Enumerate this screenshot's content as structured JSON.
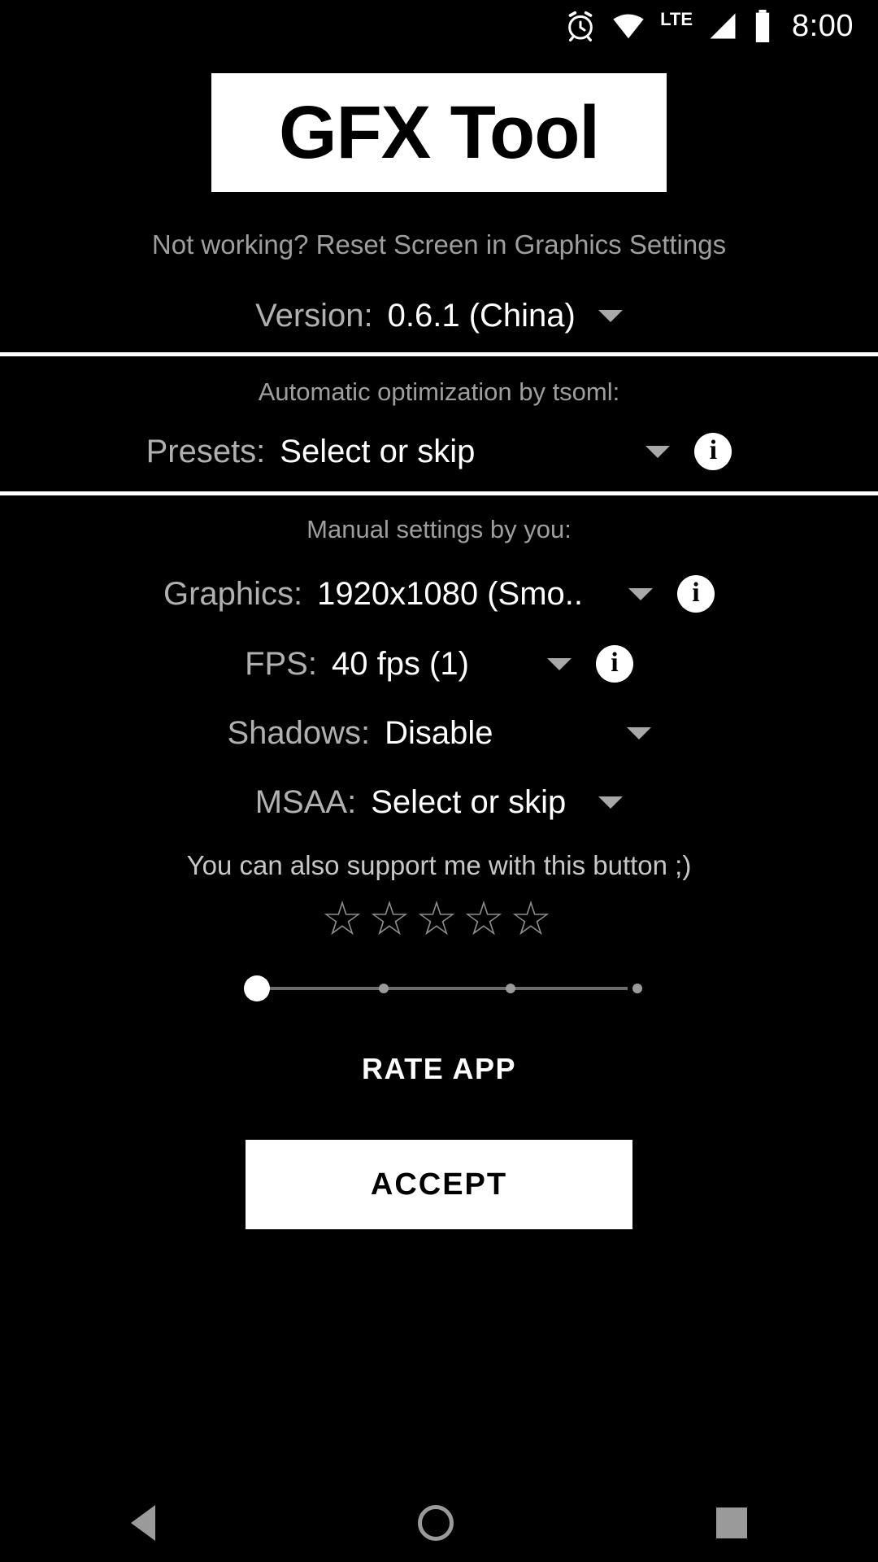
{
  "status_bar": {
    "icons": [
      "alarm-icon",
      "wifi-icon",
      "lte-icon",
      "signal-icon",
      "battery-icon"
    ],
    "network_label": "LTE",
    "time": "8:00"
  },
  "app": {
    "title": "GFX Tool",
    "hint": "Not working? Reset Screen in Graphics Settings"
  },
  "version_row": {
    "label": "Version:",
    "value": "0.6.1 (China)"
  },
  "auto_section": {
    "caption": "Automatic optimization by tsoml:",
    "presets": {
      "label": "Presets:",
      "value": "Select or skip",
      "info": "i"
    }
  },
  "manual_section": {
    "caption": "Manual settings by you:",
    "graphics": {
      "label": "Graphics:",
      "value": "1920x1080 (Smo..",
      "info": "i"
    },
    "fps": {
      "label": "FPS:",
      "value": "40 fps (1)",
      "info": "i"
    },
    "shadows": {
      "label": "Shadows:",
      "value": "Disable"
    },
    "msaa": {
      "label": "MSAA:",
      "value": "Select or skip"
    }
  },
  "support": {
    "text": "You can also support me with this button ;)",
    "stars": "☆☆☆☆☆",
    "slider": {
      "value": 0,
      "min": 0,
      "max": 3,
      "ticks": 4
    },
    "rate_label": "RATE APP"
  },
  "accept_button": {
    "label": "ACCEPT"
  },
  "nav_bar": {
    "back": "back-icon",
    "home": "home-icon",
    "recents": "recents-icon"
  },
  "colors": {
    "background": "#000000",
    "accent": "#ffffff",
    "label_gray": "#b0b0b0",
    "hint_gray": "#9e9e9e"
  }
}
